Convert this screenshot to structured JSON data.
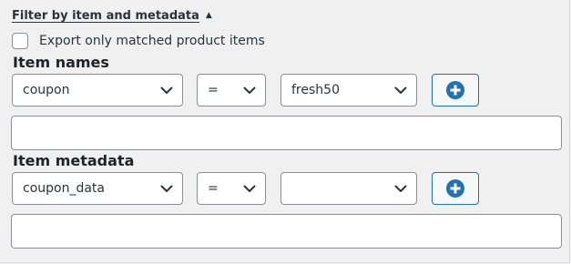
{
  "filter": {
    "toggle_label": "Filter by item and metadata",
    "toggle_arrow": "▲"
  },
  "export_only": {
    "label": "Export only matched product items",
    "checked": false
  },
  "item_names": {
    "title": "Item names",
    "field_value": "coupon",
    "operator_value": "=",
    "value_value": "fresh50",
    "text_value": ""
  },
  "item_metadata": {
    "title": "Item metadata",
    "field_value": "coupon_data",
    "operator_value": "=",
    "value_value": "",
    "text_value": ""
  },
  "colors": {
    "accent": "#2271b1",
    "background": "#f0f0f1",
    "border": "#8c8f94"
  },
  "icons": {
    "dropdown": "chevron-down-icon",
    "add": "plus-circle-icon",
    "toggle": "caret-up-icon"
  }
}
